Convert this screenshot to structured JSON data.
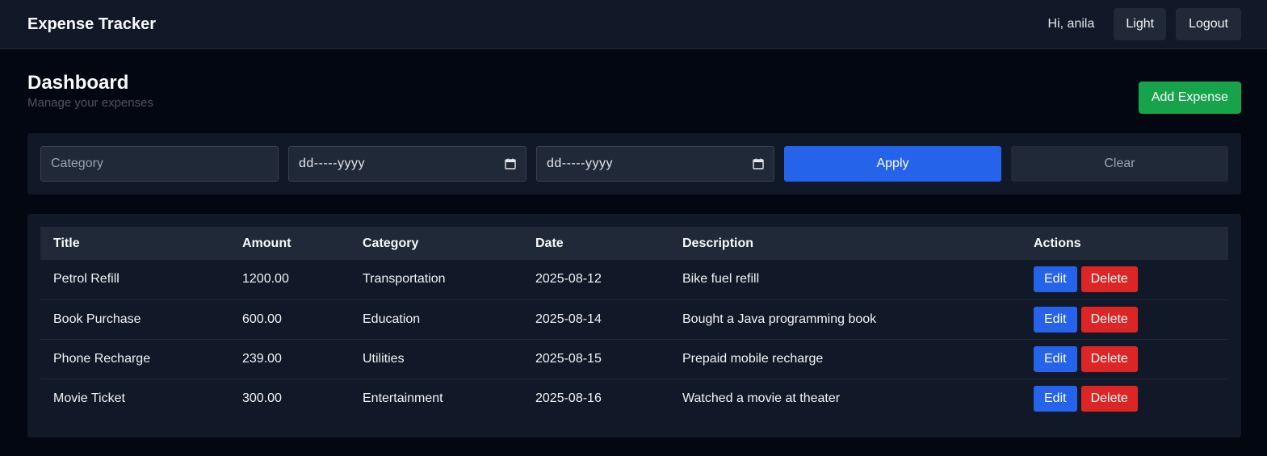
{
  "navbar": {
    "brand": "Expense Tracker",
    "greeting": "Hi, anila",
    "theme_label": "Light",
    "logout_label": "Logout"
  },
  "header": {
    "title": "Dashboard",
    "subtitle": "Manage your expenses",
    "add_label": "Add Expense"
  },
  "filters": {
    "category_placeholder": "Category",
    "from_date": "dd-----yyyy",
    "to_date": "dd-----yyyy",
    "apply_label": "Apply",
    "clear_label": "Clear"
  },
  "table": {
    "headers": [
      "Title",
      "Amount",
      "Category",
      "Date",
      "Description",
      "Actions"
    ],
    "edit_label": "Edit",
    "delete_label": "Delete",
    "rows": [
      {
        "title": "Petrol Refill",
        "amount": "1200.00",
        "category": "Transportation",
        "date": "2025-08-12",
        "description": "Bike fuel refill"
      },
      {
        "title": "Book Purchase",
        "amount": "600.00",
        "category": "Education",
        "date": "2025-08-14",
        "description": "Bought a Java programming book"
      },
      {
        "title": "Phone Recharge",
        "amount": "239.00",
        "category": "Utilities",
        "date": "2025-08-15",
        "description": "Prepaid mobile recharge"
      },
      {
        "title": "Movie Ticket",
        "amount": "300.00",
        "category": "Entertainment",
        "date": "2025-08-16",
        "description": "Watched a movie at theater"
      }
    ]
  },
  "colors": {
    "background": "#030712",
    "surface": "#111827",
    "primary": "#2563eb",
    "success": "#16a34a",
    "danger": "#dc2626"
  },
  "icons": {
    "date_picker": "calendar-icon"
  }
}
